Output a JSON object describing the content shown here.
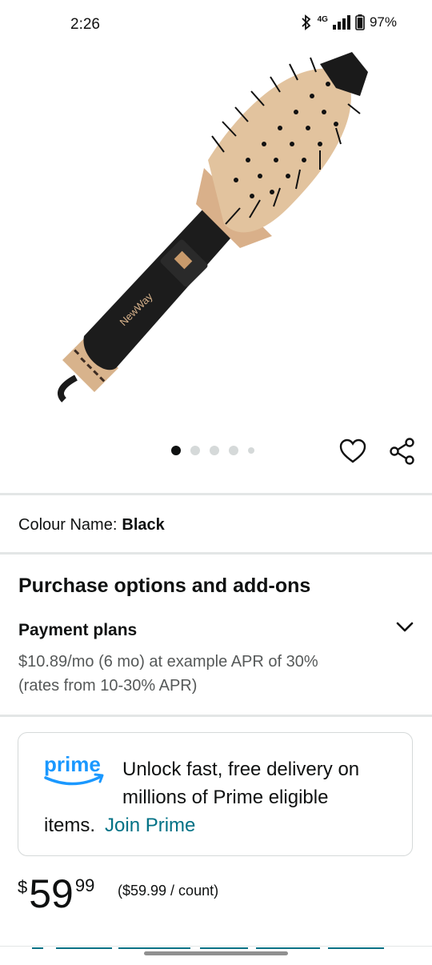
{
  "status_bar": {
    "time": "2:26",
    "network": "4G",
    "battery": "97%"
  },
  "carousel": {
    "dot_count": 5,
    "active_index": 0
  },
  "product": {
    "brand_on_item": "NewWay"
  },
  "colour": {
    "label": "Colour Name:",
    "value": "Black"
  },
  "purchase_options": {
    "title": "Purchase options and add-ons",
    "payment_plans_title": "Payment plans",
    "payment_plans_desc": "$10.89/mo (6 mo) at example APR of 30% (rates from 10-30% APR)"
  },
  "prime_card": {
    "logo_text": "prime",
    "message_line": "Unlock fast, free delivery on millions of Prime eligible",
    "message_tail": "items.",
    "join_label": "Join Prime"
  },
  "price": {
    "symbol": "$",
    "whole": "59",
    "fraction": "99",
    "per_unit": "($59.99 / count)"
  },
  "colors": {
    "accent_link": "#007185",
    "prime_blue": "#1a98ff",
    "text": "#0f1111",
    "secondary_text": "#565959"
  }
}
